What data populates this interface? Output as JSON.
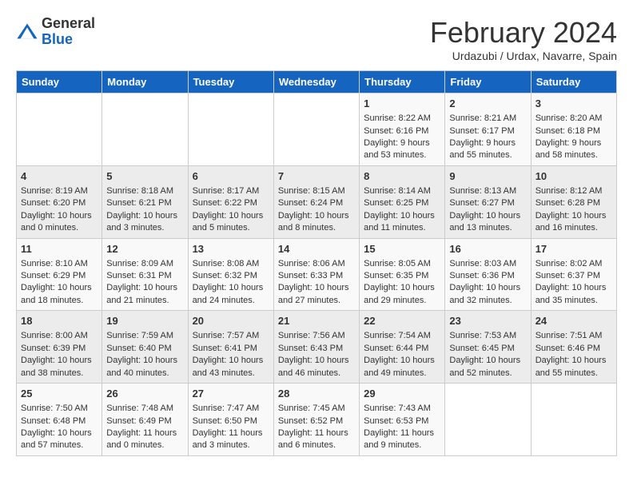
{
  "header": {
    "logo_general": "General",
    "logo_blue": "Blue",
    "month_title": "February 2024",
    "subtitle": "Urdazubi / Urdax, Navarre, Spain"
  },
  "days_of_week": [
    "Sunday",
    "Monday",
    "Tuesday",
    "Wednesday",
    "Thursday",
    "Friday",
    "Saturday"
  ],
  "weeks": [
    [
      {
        "day": "",
        "content": ""
      },
      {
        "day": "",
        "content": ""
      },
      {
        "day": "",
        "content": ""
      },
      {
        "day": "",
        "content": ""
      },
      {
        "day": "1",
        "content": "Sunrise: 8:22 AM\nSunset: 6:16 PM\nDaylight: 9 hours\nand 53 minutes."
      },
      {
        "day": "2",
        "content": "Sunrise: 8:21 AM\nSunset: 6:17 PM\nDaylight: 9 hours\nand 55 minutes."
      },
      {
        "day": "3",
        "content": "Sunrise: 8:20 AM\nSunset: 6:18 PM\nDaylight: 9 hours\nand 58 minutes."
      }
    ],
    [
      {
        "day": "4",
        "content": "Sunrise: 8:19 AM\nSunset: 6:20 PM\nDaylight: 10 hours\nand 0 minutes."
      },
      {
        "day": "5",
        "content": "Sunrise: 8:18 AM\nSunset: 6:21 PM\nDaylight: 10 hours\nand 3 minutes."
      },
      {
        "day": "6",
        "content": "Sunrise: 8:17 AM\nSunset: 6:22 PM\nDaylight: 10 hours\nand 5 minutes."
      },
      {
        "day": "7",
        "content": "Sunrise: 8:15 AM\nSunset: 6:24 PM\nDaylight: 10 hours\nand 8 minutes."
      },
      {
        "day": "8",
        "content": "Sunrise: 8:14 AM\nSunset: 6:25 PM\nDaylight: 10 hours\nand 11 minutes."
      },
      {
        "day": "9",
        "content": "Sunrise: 8:13 AM\nSunset: 6:27 PM\nDaylight: 10 hours\nand 13 minutes."
      },
      {
        "day": "10",
        "content": "Sunrise: 8:12 AM\nSunset: 6:28 PM\nDaylight: 10 hours\nand 16 minutes."
      }
    ],
    [
      {
        "day": "11",
        "content": "Sunrise: 8:10 AM\nSunset: 6:29 PM\nDaylight: 10 hours\nand 18 minutes."
      },
      {
        "day": "12",
        "content": "Sunrise: 8:09 AM\nSunset: 6:31 PM\nDaylight: 10 hours\nand 21 minutes."
      },
      {
        "day": "13",
        "content": "Sunrise: 8:08 AM\nSunset: 6:32 PM\nDaylight: 10 hours\nand 24 minutes."
      },
      {
        "day": "14",
        "content": "Sunrise: 8:06 AM\nSunset: 6:33 PM\nDaylight: 10 hours\nand 27 minutes."
      },
      {
        "day": "15",
        "content": "Sunrise: 8:05 AM\nSunset: 6:35 PM\nDaylight: 10 hours\nand 29 minutes."
      },
      {
        "day": "16",
        "content": "Sunrise: 8:03 AM\nSunset: 6:36 PM\nDaylight: 10 hours\nand 32 minutes."
      },
      {
        "day": "17",
        "content": "Sunrise: 8:02 AM\nSunset: 6:37 PM\nDaylight: 10 hours\nand 35 minutes."
      }
    ],
    [
      {
        "day": "18",
        "content": "Sunrise: 8:00 AM\nSunset: 6:39 PM\nDaylight: 10 hours\nand 38 minutes."
      },
      {
        "day": "19",
        "content": "Sunrise: 7:59 AM\nSunset: 6:40 PM\nDaylight: 10 hours\nand 40 minutes."
      },
      {
        "day": "20",
        "content": "Sunrise: 7:57 AM\nSunset: 6:41 PM\nDaylight: 10 hours\nand 43 minutes."
      },
      {
        "day": "21",
        "content": "Sunrise: 7:56 AM\nSunset: 6:43 PM\nDaylight: 10 hours\nand 46 minutes."
      },
      {
        "day": "22",
        "content": "Sunrise: 7:54 AM\nSunset: 6:44 PM\nDaylight: 10 hours\nand 49 minutes."
      },
      {
        "day": "23",
        "content": "Sunrise: 7:53 AM\nSunset: 6:45 PM\nDaylight: 10 hours\nand 52 minutes."
      },
      {
        "day": "24",
        "content": "Sunrise: 7:51 AM\nSunset: 6:46 PM\nDaylight: 10 hours\nand 55 minutes."
      }
    ],
    [
      {
        "day": "25",
        "content": "Sunrise: 7:50 AM\nSunset: 6:48 PM\nDaylight: 10 hours\nand 57 minutes."
      },
      {
        "day": "26",
        "content": "Sunrise: 7:48 AM\nSunset: 6:49 PM\nDaylight: 11 hours\nand 0 minutes."
      },
      {
        "day": "27",
        "content": "Sunrise: 7:47 AM\nSunset: 6:50 PM\nDaylight: 11 hours\nand 3 minutes."
      },
      {
        "day": "28",
        "content": "Sunrise: 7:45 AM\nSunset: 6:52 PM\nDaylight: 11 hours\nand 6 minutes."
      },
      {
        "day": "29",
        "content": "Sunrise: 7:43 AM\nSunset: 6:53 PM\nDaylight: 11 hours\nand 9 minutes."
      },
      {
        "day": "",
        "content": ""
      },
      {
        "day": "",
        "content": ""
      }
    ]
  ]
}
